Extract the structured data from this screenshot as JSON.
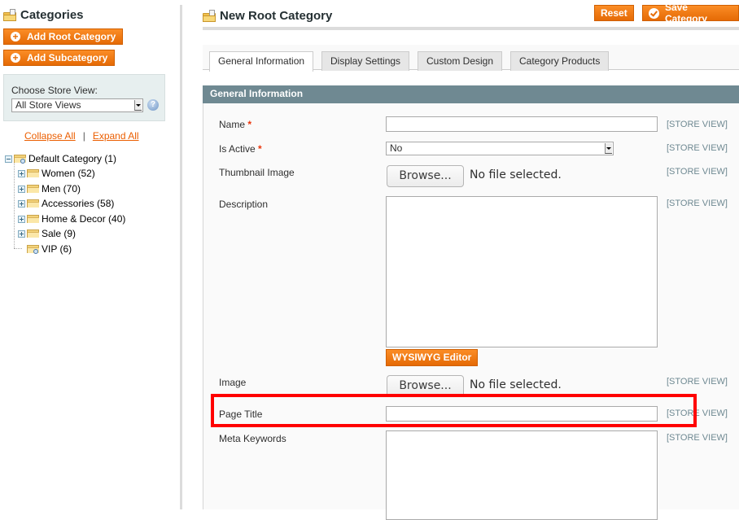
{
  "sidebar": {
    "title": "Categories",
    "add_root_label": "Add Root Category",
    "add_sub_label": "Add Subcategory",
    "store_view": {
      "label": "Choose Store View:",
      "selected": "All Store Views",
      "help_icon": "?"
    },
    "collapse_all": "Collapse All",
    "separator": "|",
    "expand_all": "Expand All",
    "tree": {
      "root": {
        "label": "Default Category (1)",
        "expanded": true
      },
      "children": [
        {
          "label": "Women (52)",
          "expandable": true
        },
        {
          "label": "Men (70)",
          "expandable": true
        },
        {
          "label": "Accessories (58)",
          "expandable": true
        },
        {
          "label": "Home & Decor (40)",
          "expandable": true
        },
        {
          "label": "Sale (9)",
          "expandable": true
        },
        {
          "label": "VIP (6)",
          "expandable": false
        }
      ]
    }
  },
  "header": {
    "title": "New Root Category",
    "reset_label": "Reset",
    "save_label": "Save Category"
  },
  "tabs": [
    {
      "label": "General Information",
      "active": true
    },
    {
      "label": "Display Settings",
      "active": false
    },
    {
      "label": "Custom Design",
      "active": false
    },
    {
      "label": "Category Products",
      "active": false
    }
  ],
  "form": {
    "section_title": "General Information",
    "required_mark": "*",
    "scope_label": "[STORE VIEW]",
    "fields": {
      "name": {
        "label": "Name",
        "value": ""
      },
      "is_active": {
        "label": "Is Active",
        "value": "No"
      },
      "thumbnail": {
        "label": "Thumbnail Image",
        "browse": "Browse...",
        "status": "No file selected."
      },
      "description": {
        "label": "Description",
        "value": "",
        "wysiwyg": "WYSIWYG Editor"
      },
      "image": {
        "label": "Image",
        "browse": "Browse...",
        "status": "No file selected."
      },
      "page_title": {
        "label": "Page Title",
        "value": ""
      },
      "meta_keywords": {
        "label": "Meta Keywords",
        "value": ""
      }
    }
  },
  "colors": {
    "accent_orange": "#eb6a0b",
    "fieldset_header": "#6f8992",
    "highlight": "#ff0000",
    "link": "#eb5e00"
  }
}
